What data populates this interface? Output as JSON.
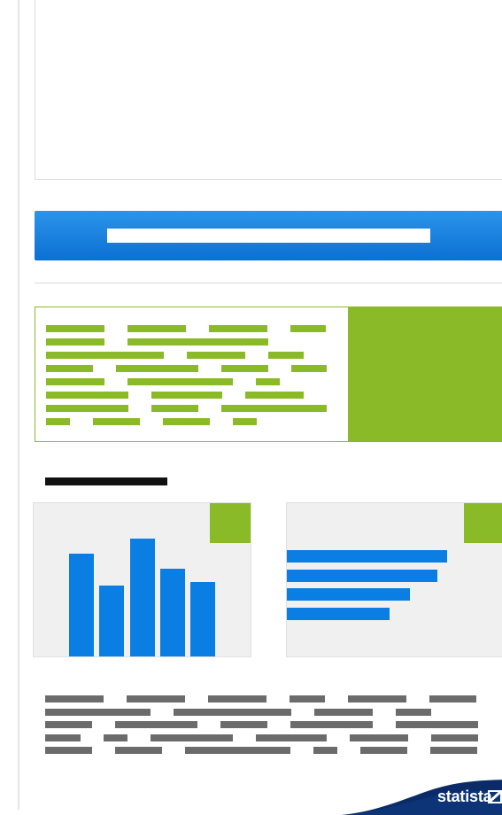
{
  "brand": {
    "logo_text": "statista",
    "primary_color": "#0a7ee3",
    "accent_color": "#8aba27",
    "text_placeholder_color": "#6b6b6b"
  },
  "cta": {
    "label": ""
  },
  "promo": {
    "text": ""
  },
  "section": {
    "heading": ""
  },
  "cards": [
    {
      "kind": "bar-chart-preview",
      "icon": "bar-chart-icon"
    },
    {
      "kind": "horizontal-bar-preview",
      "icon": "horizontal-bar-chart-icon"
    }
  ],
  "body": {
    "text": ""
  }
}
